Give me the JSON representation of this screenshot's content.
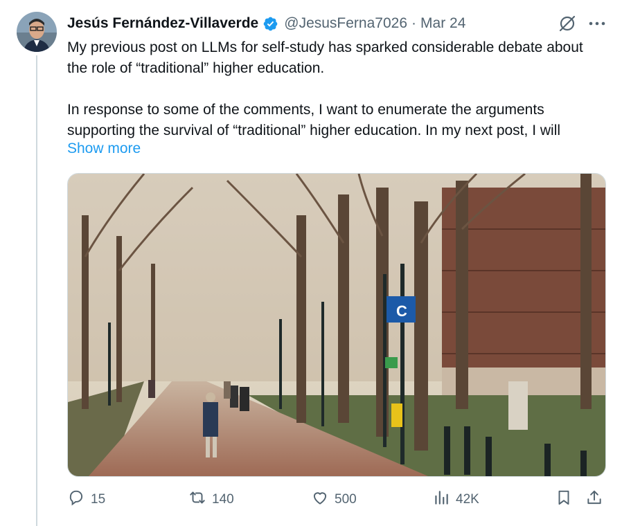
{
  "author": {
    "name": "Jesús Fernández-Villaverde",
    "handle": "@JesusFerna7026",
    "date": "Mar 24",
    "verified": true
  },
  "post": {
    "paragraph1": "My previous post on LLMs for self-study has sparked considerable debate about the role of “traditional” higher education.",
    "paragraph2": "In response to some of the comments, I want to enumerate the arguments supporting the survival of “traditional” higher education. In my next post, I will",
    "show_more": "Show more"
  },
  "media": {
    "description_icon": "campus-walkway-photo",
    "emergency_sign_letter": "C"
  },
  "actions": {
    "replies": "15",
    "reposts": "140",
    "likes": "500",
    "views": "42K"
  },
  "colors": {
    "accent": "#1d9bf0",
    "muted": "#536471",
    "text": "#0f1419"
  }
}
